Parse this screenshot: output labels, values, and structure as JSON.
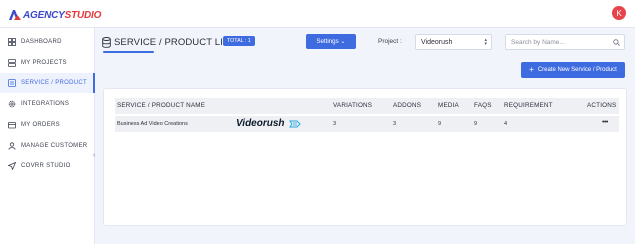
{
  "app": {
    "logo_brand": "AGENCY STUDIO",
    "logo_part1": "AGENCY",
    "logo_part2": "STUDIO",
    "user_initial": "K"
  },
  "colors": {
    "accent": "#3f6be0",
    "brand_blue": "#3b49c9",
    "brand_red": "#e53a3a",
    "avatar": "#e8424a"
  },
  "sidebar": {
    "items": [
      {
        "label": "DASHBOARD",
        "icon": "grid-icon"
      },
      {
        "label": "MY PROJECTS",
        "icon": "projects-icon"
      },
      {
        "label": "SERVICE / PRODUCT",
        "icon": "service-icon",
        "active": true
      },
      {
        "label": "INTEGRATIONS",
        "icon": "gear-icon"
      },
      {
        "label": "MY ORDERS",
        "icon": "orders-icon"
      },
      {
        "label": "MANAGE CUSTOMER",
        "icon": "user-icon"
      },
      {
        "label": "COVRR STUDIO",
        "icon": "send-icon"
      }
    ]
  },
  "header": {
    "title": "SERVICE / PRODUCT LIST",
    "total_badge": "TOTAL : 1",
    "settings_label": "Settings ⌄",
    "project_label": "Project :",
    "project_value": "Videorush",
    "search_placeholder": "Search by Name...",
    "create_label": "Create New Service / Product"
  },
  "table": {
    "columns": [
      "SERVICE / PRODUCT NAME",
      "VARIATIONS",
      "ADDONS",
      "MEDIA",
      "FAQS",
      "REQUIREMENT",
      "ACTIONS"
    ],
    "rows": [
      {
        "name": "Business Ad Video Creations",
        "brand": "Videorush",
        "variations": "3",
        "addons": "3",
        "media": "9",
        "faqs": "9",
        "requirement": "4",
        "actions": "•••"
      }
    ]
  }
}
